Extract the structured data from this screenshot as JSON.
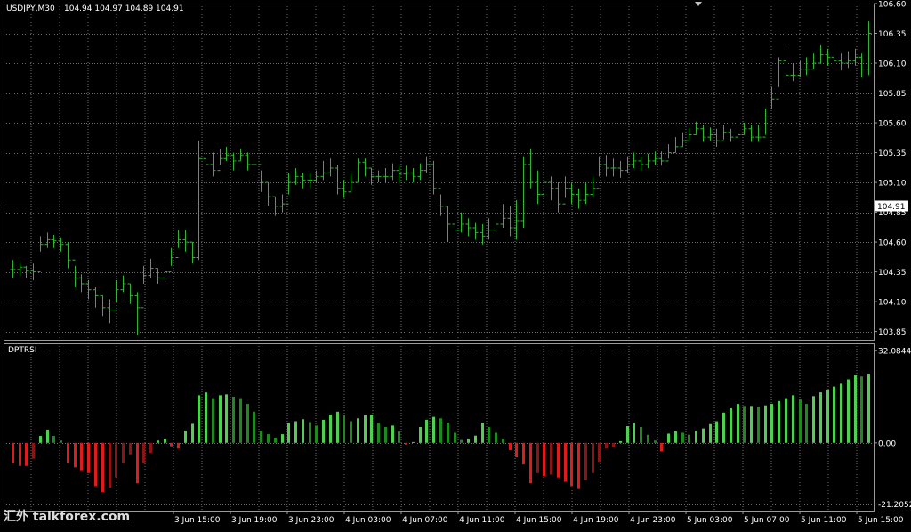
{
  "header": {
    "symbol": "USDJPY,M30",
    "ohlc": "104.94 104.97 104.89 104.91"
  },
  "indicator": {
    "name": "DPTRSI"
  },
  "watermark": {
    "text": "汇外 talkforex.com"
  },
  "colors": {
    "background": "#000000",
    "grid": "#6e6e6e",
    "frame": "#9a9a9a",
    "candle": "#2fb52f",
    "text": "#ffffff",
    "current_price_line": "#7e8ea6",
    "hist_positive_bright": "#4ed14e",
    "hist_positive_dark": "#1e8a1e",
    "hist_negative_bright": "#e01b1b",
    "hist_negative_dark": "#8c1414"
  },
  "chart_data": [
    {
      "type": "candlestick",
      "symbol": "USDJPY",
      "timeframe": "M30",
      "title": "USDJPY,M30",
      "ylim": [
        103.78,
        106.6
      ],
      "y_ticks": [
        "106.60",
        "106.35",
        "106.10",
        "105.85",
        "105.60",
        "105.35",
        "105.10",
        "104.85",
        "104.60",
        "104.35",
        "104.10",
        "103.85"
      ],
      "current_price": "104.91",
      "x_ticks": [
        "3 Jun 15:00",
        "3 Jun 19:00",
        "3 Jun 23:00",
        "4 Jun 03:00",
        "4 Jun 07:00",
        "4 Jun 11:00",
        "4 Jun 15:00",
        "4 Jun 19:00",
        "4 Jun 23:00",
        "5 Jun 03:00",
        "5 Jun 07:00",
        "5 Jun 11:00",
        "5 Jun 15:00"
      ],
      "grid": true,
      "close": [
        104.37,
        104.39,
        104.36,
        104.35,
        104.58,
        104.62,
        104.61,
        104.58,
        104.45,
        104.3,
        104.25,
        104.2,
        104.15,
        104.05,
        104.03,
        104.2,
        104.25,
        104.15,
        104.05,
        104.32,
        104.38,
        104.3,
        104.35,
        104.47,
        104.62,
        104.6,
        104.47,
        105.3,
        105.25,
        105.2,
        105.3,
        105.33,
        105.28,
        105.33,
        105.25,
        105.25,
        105.1,
        104.98,
        104.9,
        104.92,
        105.1,
        105.15,
        105.12,
        105.12,
        105.15,
        105.18,
        105.22,
        105.05,
        105.02,
        105.1,
        105.27,
        105.22,
        105.15,
        105.15,
        105.15,
        105.2,
        105.17,
        105.18,
        105.15,
        105.2,
        105.25,
        105.05,
        104.9,
        104.75,
        104.7,
        104.75,
        104.72,
        104.68,
        104.65,
        104.7,
        104.75,
        104.8,
        104.72,
        104.78,
        105.25,
        105.1,
        105.0,
        105.1,
        105.05,
        104.92,
        105.05,
        105.0,
        104.95,
        105.0,
        105.05,
        105.25,
        105.22,
        105.22,
        105.2,
        105.25,
        105.28,
        105.25,
        105.28,
        105.3,
        105.28,
        105.35,
        105.4,
        105.45,
        105.5,
        105.55,
        105.48,
        105.5,
        105.45,
        105.52,
        105.48,
        105.5,
        105.55,
        105.48,
        105.48,
        105.65,
        105.8,
        106.12,
        106.0,
        106.0,
        106.05,
        106.05,
        106.1,
        106.17,
        106.15,
        106.12,
        106.1,
        106.12,
        106.15,
        106.05,
        106.35
      ],
      "high": [
        104.45,
        104.43,
        104.4,
        104.42,
        104.65,
        104.68,
        104.66,
        104.64,
        104.6,
        104.4,
        104.33,
        104.28,
        104.22,
        104.15,
        104.12,
        104.28,
        104.32,
        104.25,
        104.18,
        104.4,
        104.46,
        104.38,
        104.45,
        104.55,
        104.7,
        104.7,
        104.6,
        105.45,
        105.6,
        105.35,
        105.38,
        105.4,
        105.35,
        105.38,
        105.35,
        105.32,
        105.2,
        105.1,
        104.98,
        105.0,
        105.18,
        105.22,
        105.18,
        105.18,
        105.2,
        105.28,
        105.3,
        105.25,
        105.12,
        105.18,
        105.3,
        105.3,
        105.22,
        105.2,
        105.22,
        105.26,
        105.24,
        105.24,
        105.22,
        105.26,
        105.32,
        105.28,
        105.0,
        104.9,
        104.85,
        104.85,
        104.8,
        104.76,
        104.75,
        104.8,
        104.85,
        104.92,
        104.9,
        104.95,
        105.32,
        105.38,
        105.2,
        105.18,
        105.15,
        105.1,
        105.15,
        105.1,
        105.05,
        105.1,
        105.15,
        105.32,
        105.33,
        105.3,
        105.28,
        105.32,
        105.35,
        105.32,
        105.34,
        105.36,
        105.36,
        105.42,
        105.48,
        105.52,
        105.56,
        105.61,
        105.58,
        105.56,
        105.55,
        105.58,
        105.55,
        105.56,
        105.6,
        105.58,
        105.58,
        105.72,
        105.9,
        106.15,
        106.22,
        106.1,
        106.12,
        106.15,
        106.18,
        106.25,
        106.22,
        106.2,
        106.18,
        106.2,
        106.22,
        106.18,
        106.45
      ],
      "low": [
        104.3,
        104.32,
        104.3,
        104.28,
        104.52,
        104.55,
        104.55,
        104.52,
        104.38,
        104.22,
        104.18,
        104.12,
        104.05,
        103.98,
        103.92,
        104.1,
        104.18,
        104.08,
        103.82,
        104.25,
        104.3,
        104.25,
        104.28,
        104.4,
        104.55,
        104.52,
        104.42,
        104.45,
        105.18,
        105.15,
        105.25,
        105.28,
        105.2,
        105.28,
        105.2,
        105.18,
        105.02,
        104.9,
        104.82,
        104.85,
        105.0,
        105.08,
        105.05,
        105.06,
        105.1,
        105.12,
        105.15,
        105.0,
        104.97,
        105.02,
        105.1,
        105.15,
        105.08,
        105.1,
        105.1,
        105.12,
        105.1,
        105.12,
        105.1,
        105.12,
        105.18,
        105.0,
        104.82,
        104.6,
        104.62,
        104.68,
        104.65,
        104.62,
        104.58,
        104.62,
        104.68,
        104.72,
        104.65,
        104.62,
        104.72,
        105.05,
        104.92,
        105.0,
        104.95,
        104.85,
        104.97,
        104.92,
        104.88,
        104.92,
        104.98,
        105.15,
        105.15,
        105.15,
        105.14,
        105.18,
        105.22,
        105.2,
        105.22,
        105.25,
        105.24,
        105.3,
        105.35,
        105.4,
        105.46,
        105.5,
        105.44,
        105.45,
        105.4,
        105.46,
        105.44,
        105.46,
        105.5,
        105.44,
        105.44,
        105.5,
        105.72,
        105.9,
        105.95,
        105.95,
        105.98,
        106.0,
        106.05,
        106.1,
        106.08,
        106.05,
        106.04,
        106.06,
        106.08,
        105.98,
        106.0
      ]
    },
    {
      "type": "bar",
      "title": "DPTRSI",
      "ylim": [
        -23.5,
        34.5
      ],
      "y_ticks": [
        "32.0844",
        "0.00",
        "-21.2052"
      ],
      "grid": true,
      "values": [
        -7.0,
        -8.0,
        -8.0,
        -5.5,
        2.4,
        4.6,
        2.4,
        0.8,
        -7.0,
        -8.5,
        -9.5,
        -10.5,
        -15.0,
        -17.0,
        -15.5,
        -12.0,
        -7.0,
        -4.0,
        -14.0,
        -7.0,
        -3.5,
        0.8,
        1.3,
        -1.2,
        -2.0,
        4.2,
        6.6,
        16.5,
        17.5,
        15.5,
        16.5,
        16.8,
        16.0,
        15.5,
        13.5,
        10.8,
        4.2,
        3.0,
        1.8,
        3.0,
        6.8,
        7.5,
        8.2,
        7.2,
        6.0,
        8.0,
        9.8,
        10.8,
        9.5,
        7.5,
        8.5,
        9.5,
        9.8,
        7.0,
        5.5,
        6.0,
        4.0,
        -0.6,
        0.3,
        5.5,
        8.0,
        9.0,
        8.5,
        7.0,
        3.5,
        1.0,
        1.5,
        2.5,
        7.0,
        5.5,
        3.5,
        1.5,
        -2.5,
        -5.0,
        -7.5,
        -14.0,
        -10.5,
        -11.5,
        -11.0,
        -12.0,
        -13.5,
        -15.0,
        -16.0,
        -13.0,
        -10.5,
        -6.5,
        -2.0,
        -1.5,
        0.6,
        5.8,
        7.0,
        5.5,
        2.8,
        0.8,
        -3.0,
        3.2,
        4.0,
        3.5,
        2.8,
        4.2,
        5.0,
        6.5,
        7.5,
        10.5,
        12.0,
        13.5,
        12.8,
        12.8,
        12.5,
        13.0,
        13.5,
        14.5,
        15.5,
        16.5,
        15.0,
        13.5,
        16.2,
        17.5,
        18.5,
        19.5,
        20.5,
        22.0,
        23.5,
        23.0,
        24.0
      ]
    }
  ]
}
